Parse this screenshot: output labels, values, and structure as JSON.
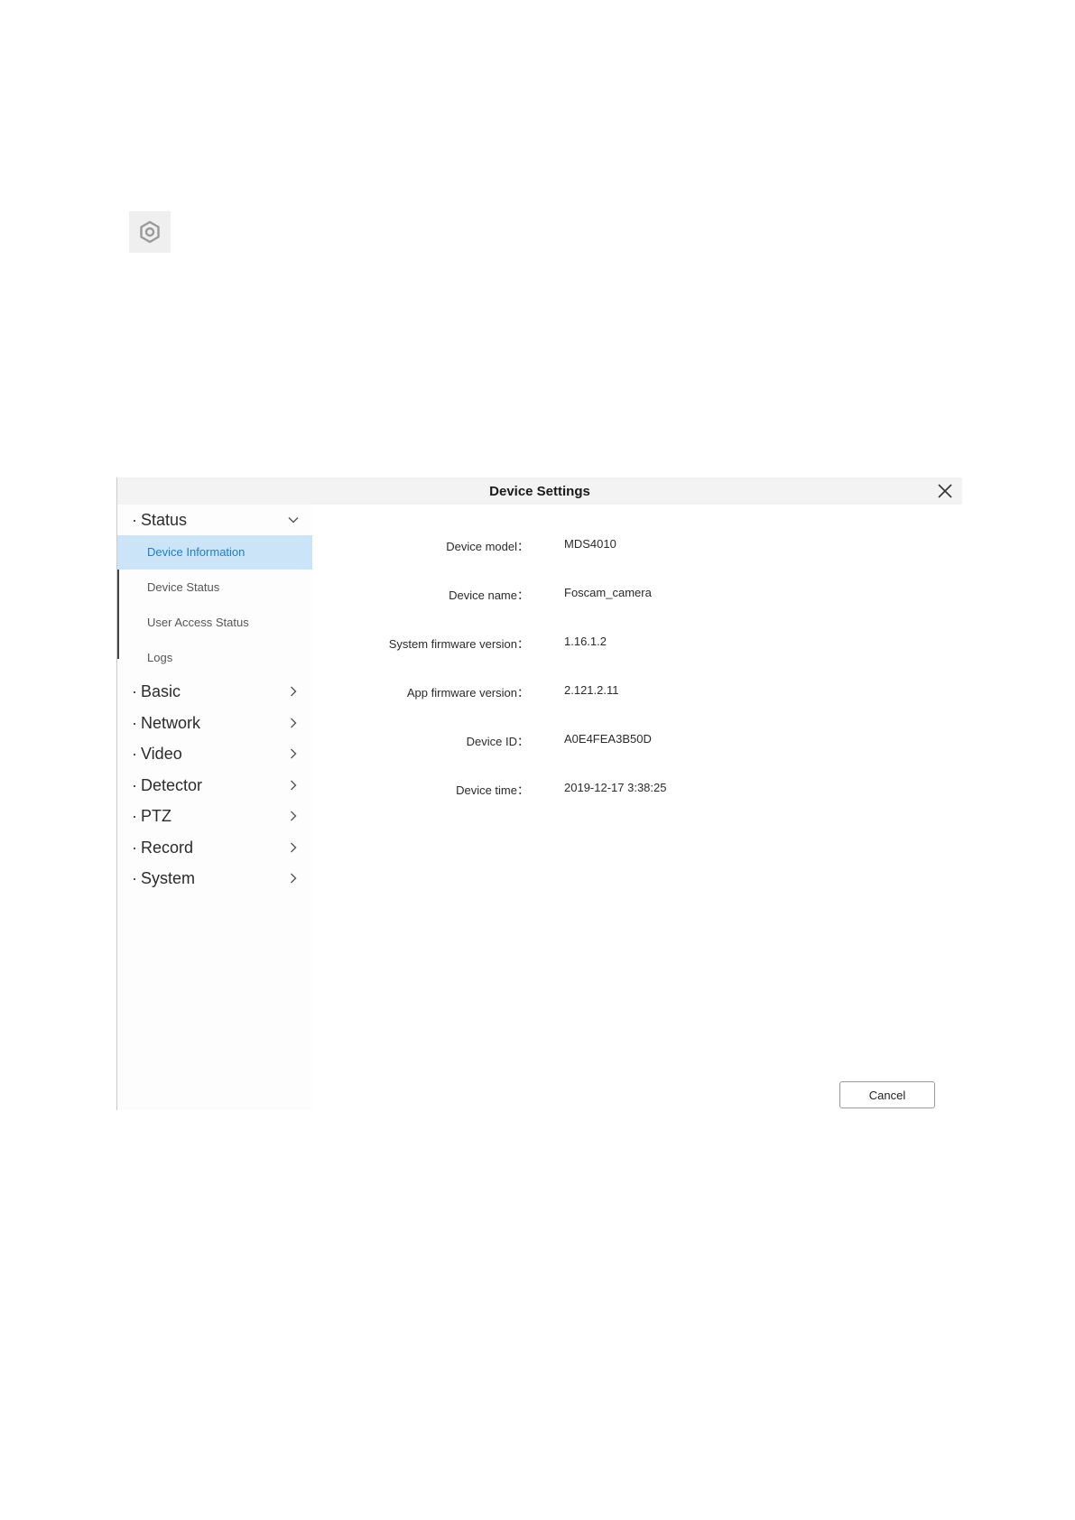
{
  "gear": {
    "icon": "gear-icon"
  },
  "dialog": {
    "title": "Device Settings",
    "close_icon": "close-icon"
  },
  "sidebar": {
    "status": {
      "bullet": "·",
      "label": "Status",
      "expanded": true,
      "items": [
        {
          "label": "Device Information",
          "active": true
        },
        {
          "label": "Device Status",
          "active": false
        },
        {
          "label": "User Access Status",
          "active": false
        },
        {
          "label": "Logs",
          "active": false
        }
      ]
    },
    "groups": [
      {
        "bullet": "·",
        "label": "Basic"
      },
      {
        "bullet": "·",
        "label": "Network"
      },
      {
        "bullet": "·",
        "label": "Video"
      },
      {
        "bullet": "·",
        "label": "Detector"
      },
      {
        "bullet": "·",
        "label": "PTZ"
      },
      {
        "bullet": "·",
        "label": "Record"
      },
      {
        "bullet": "·",
        "label": "System"
      }
    ]
  },
  "info": {
    "fields": [
      {
        "label": "Device model：",
        "value": "MDS4010"
      },
      {
        "label": "Device name：",
        "value": "Foscam_camera"
      },
      {
        "label": "System firmware version：",
        "value": "1.16.1.2"
      },
      {
        "label": "App firmware version：",
        "value": "2.121.2.11"
      },
      {
        "label": "Device ID：",
        "value": "A0E4FEA3B50D"
      },
      {
        "label": "Device time：",
        "value": "2019-12-17 3:38:25"
      }
    ]
  },
  "footer": {
    "cancel_label": "Cancel"
  },
  "colors": {
    "active_bg": "#cce4f8",
    "active_text": "#1a7fd4",
    "titlebar_bg": "#f3f3f3"
  }
}
